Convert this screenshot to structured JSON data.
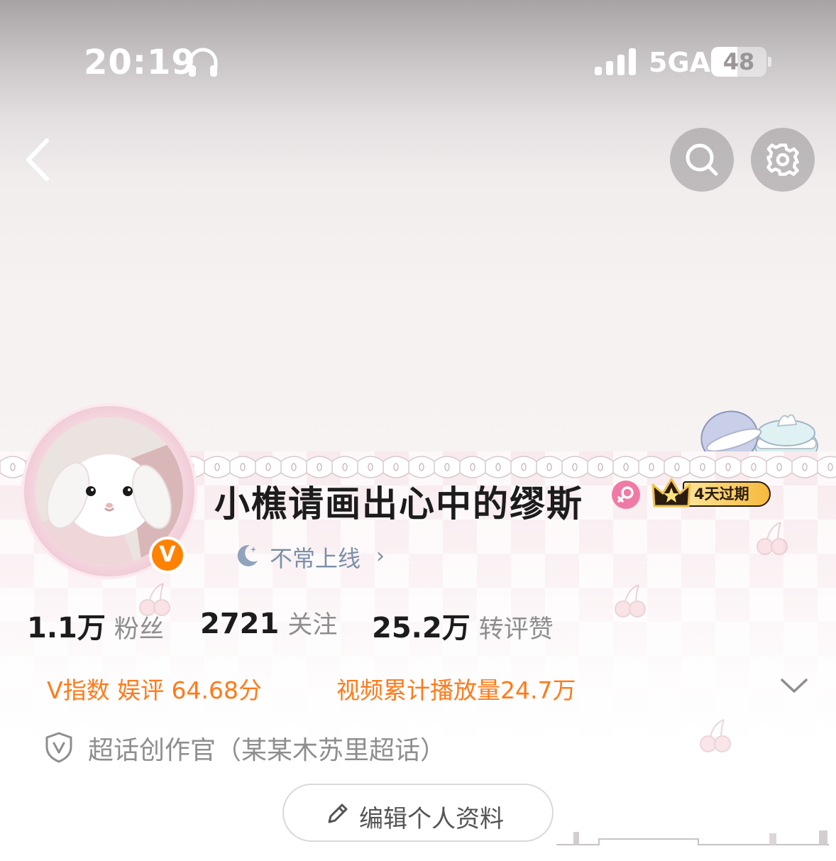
{
  "status_bar": {
    "time": "20:19",
    "network": "5GA",
    "battery_level": "48",
    "battery_fraction": 0.48
  },
  "icons": {
    "back": "chevron-left-icon",
    "search": "search-icon",
    "settings": "gear-icon",
    "headphones": "headphones-icon",
    "signal": "signal-bars-icon",
    "moon": "moon-icon",
    "expand": "chevron-down-icon",
    "shield": "shield-v-icon",
    "edit": "pencil-icon"
  },
  "profile": {
    "username": "小樵请画出心中的缪斯",
    "verified_badge": "V",
    "vip_expiry": "4天过期",
    "online_status": "不常上线",
    "online_chevron": "›"
  },
  "stats": {
    "followers_count": "1.1万",
    "followers_label": "粉丝",
    "following_count": "2721",
    "following_label": "关注",
    "likes_count": "25.2万",
    "likes_label": "转评赞"
  },
  "info": {
    "v_index": "V指数 娱评 64.68分",
    "video_plays": "视频累计播放量24.7万",
    "super_topic_role": "超话创作官（某某木苏里超话）"
  },
  "actions": {
    "edit_profile": "编辑个人资料"
  },
  "colors": {
    "accent_orange": "#ff7a1a",
    "verify_orange": "#ff8200",
    "online_blue": "#7c8fa8",
    "female_pink": "#f07aa5"
  }
}
